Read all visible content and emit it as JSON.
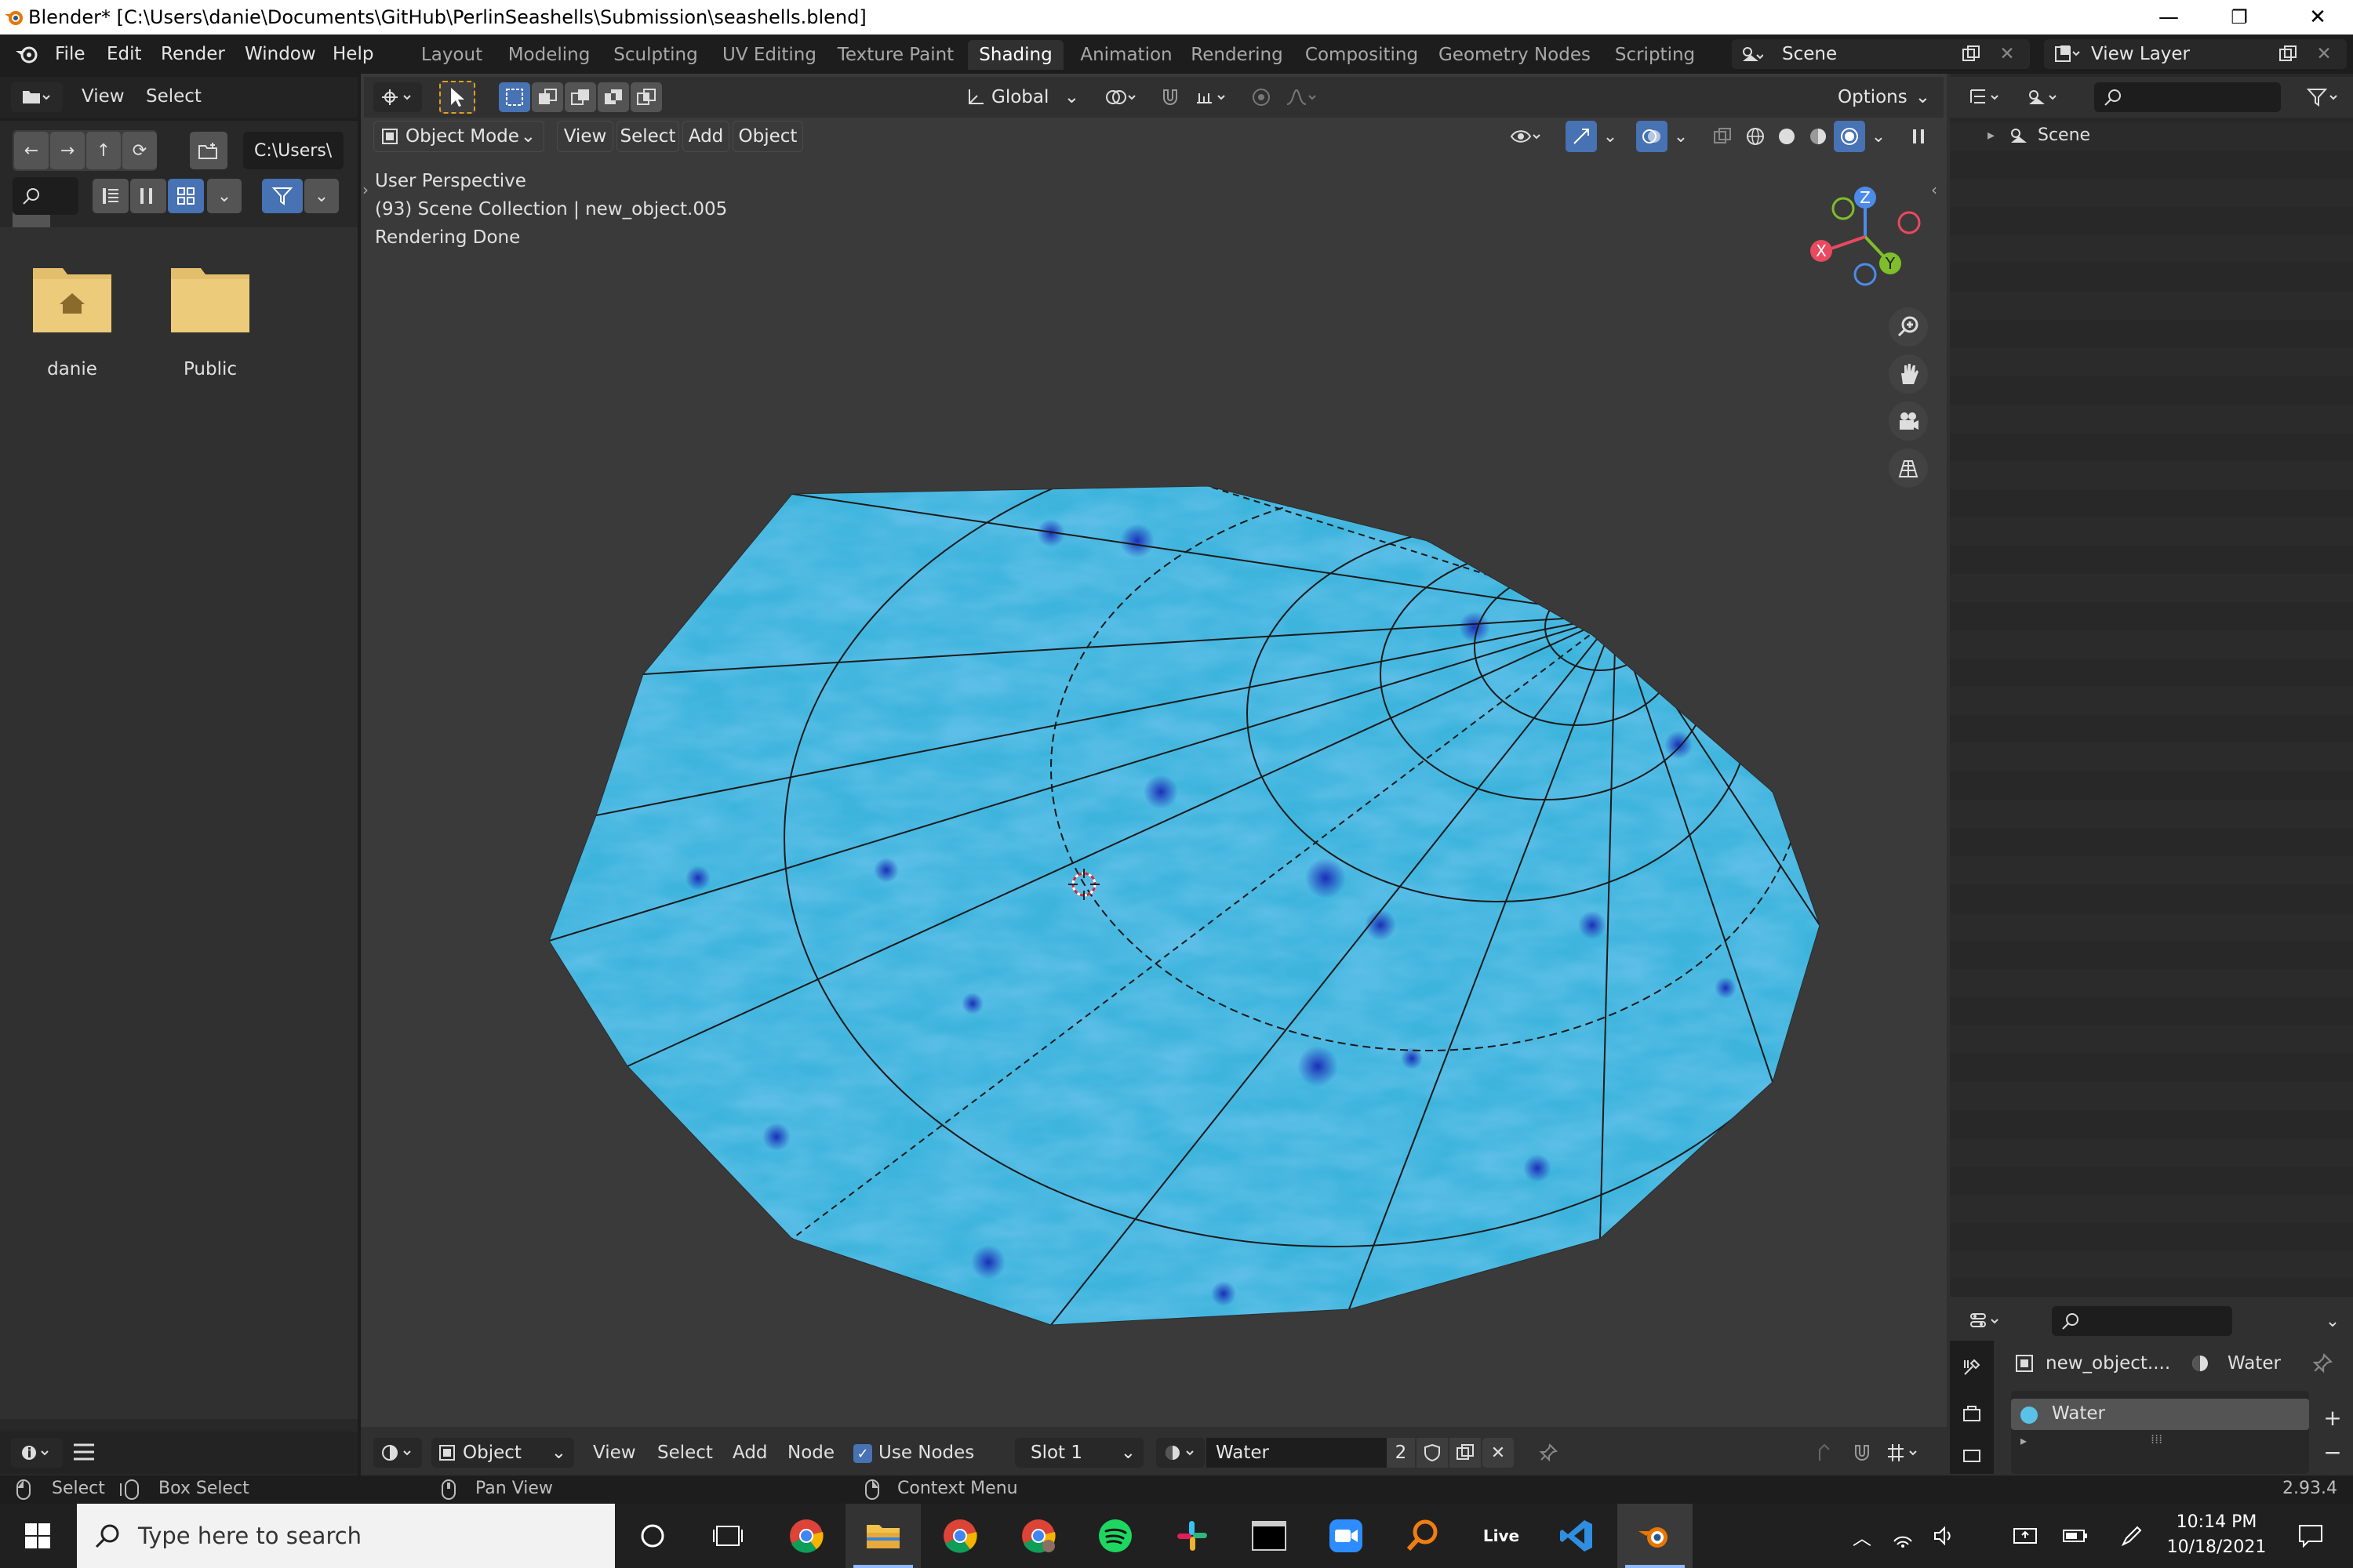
{
  "window": {
    "title": "Blender* [C:\\Users\\danie\\Documents\\GitHub\\PerlinSeashells\\Submission\\seashells.blend]",
    "minimize": "—",
    "restore": "❐",
    "close": "✕"
  },
  "menu": [
    "File",
    "Edit",
    "Render",
    "Window",
    "Help"
  ],
  "workspaces": [
    "Layout",
    "Modeling",
    "Sculpting",
    "UV Editing",
    "Texture Paint",
    "Shading",
    "Animation",
    "Rendering",
    "Compositing",
    "Geometry Nodes",
    "Scripting"
  ],
  "active_workspace": "Shading",
  "scene_field": "Scene",
  "view_layer_field": "View Layer",
  "file_browser": {
    "header": [
      "View",
      "Select"
    ],
    "path": "C:\\Users\\",
    "items": [
      {
        "label": "danie",
        "icon": "home-folder-icon"
      },
      {
        "label": "Public",
        "icon": "folder-icon"
      }
    ]
  },
  "viewport": {
    "transform_orientation": "Global",
    "options": "Options",
    "mode": "Object Mode",
    "header_menu": [
      "View",
      "Select",
      "Add",
      "Object"
    ],
    "overlay_lines": [
      "User Perspective",
      "(93) Scene Collection | new_object.005",
      "Rendering Done"
    ],
    "gizmo": {
      "x": "X",
      "y": "Y",
      "z": "Z"
    }
  },
  "outliner": {
    "scene_label": "Scene"
  },
  "properties": {
    "object_name": "new_object....",
    "material_name": "Water",
    "material_slot_label": "Water"
  },
  "node_editor": {
    "object_type": "Object",
    "menu": [
      "View",
      "Select",
      "Add",
      "Node"
    ],
    "use_nodes_label": "Use Nodes",
    "use_nodes_checked": true,
    "slot": "Slot 1",
    "material": "Water",
    "users": "2"
  },
  "statusbar": {
    "select": "Select",
    "box_select": "Box Select",
    "pan_view": "Pan View",
    "context_menu": "Context Menu",
    "version": "2.93.4"
  },
  "taskbar": {
    "search_placeholder": "Type here to search",
    "time": "10:14 PM",
    "date": "10/18/2021",
    "live_label": "Live"
  },
  "colors": {
    "accent": "#4772b3",
    "water": "#3cb4dc",
    "header": "#232323",
    "panel": "#303030"
  }
}
